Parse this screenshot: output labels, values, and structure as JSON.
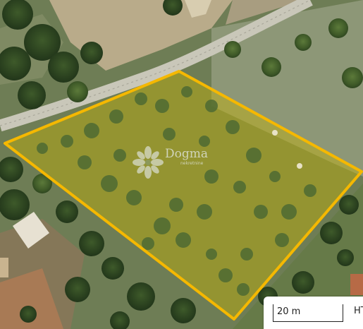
{
  "map": {
    "watermark_text": "Dogma",
    "watermark_subtext": "nekretnine",
    "parcel_outline_color": "#f5b800",
    "parcel_fill_color": "#c8b400"
  },
  "scale": {
    "label": "20 m",
    "extra_text": "HT"
  }
}
